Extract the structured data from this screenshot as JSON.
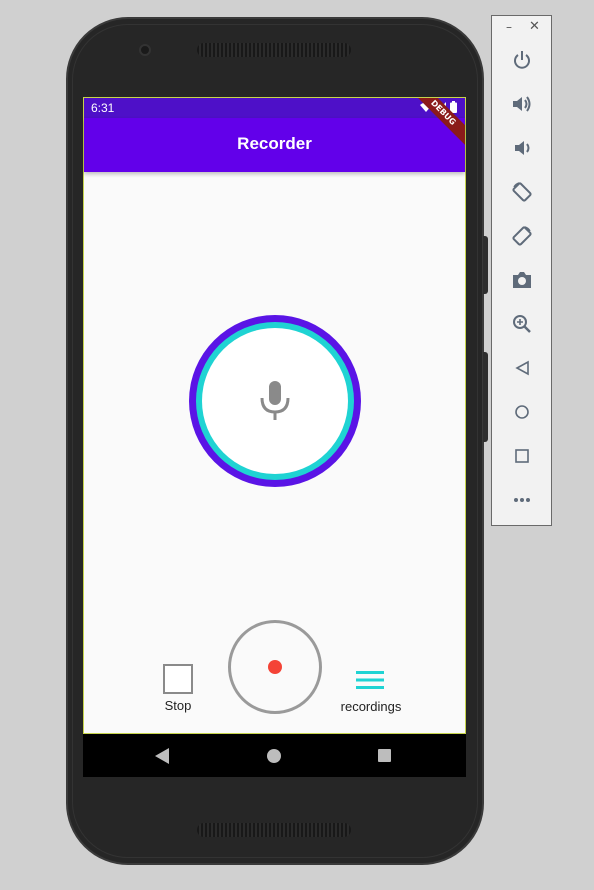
{
  "status_bar": {
    "time": "6:31"
  },
  "app_bar": {
    "title": "Recorder",
    "debug_banner": "DEBUG"
  },
  "controls": {
    "stop_label": "Stop",
    "recordings_label": "recordings"
  },
  "colors": {
    "primary": "#6200ea",
    "status": "#4e10c8",
    "ring_outer": "#5a14e6",
    "ring_inner": "#1fd3d3",
    "record": "#f44336",
    "recordings_icon": "#1fd3d3"
  },
  "emulator_toolbar": {
    "window_controls": [
      "minimize-icon",
      "close-icon"
    ],
    "buttons": [
      "power-icon",
      "volume-up-icon",
      "volume-down-icon",
      "rotate-left-icon",
      "rotate-right-icon",
      "camera-icon",
      "zoom-icon",
      "back-icon",
      "home-icon",
      "overview-icon",
      "more-icon"
    ]
  }
}
